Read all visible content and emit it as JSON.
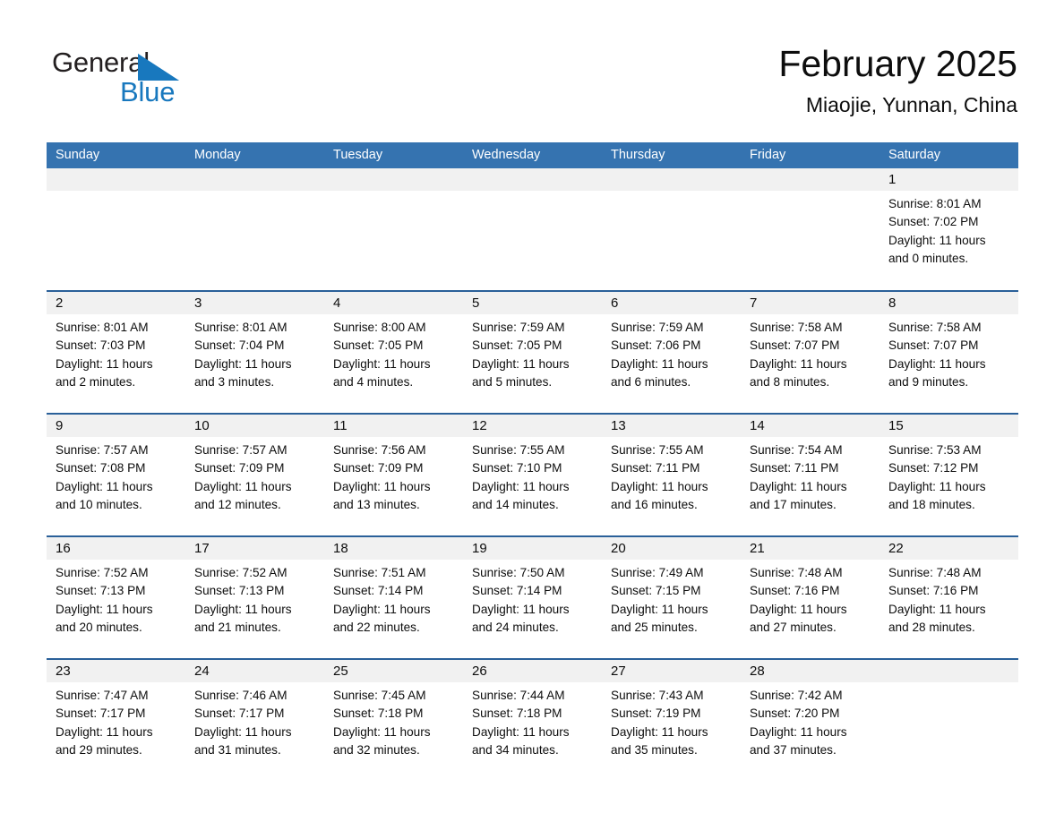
{
  "brand": {
    "name_part1": "General",
    "name_part2": "Blue",
    "triangle_color": "#1878be",
    "text_color": "#231f20"
  },
  "header": {
    "month_title": "February 2025",
    "location": "Miaojie, Yunnan, China"
  },
  "theme": {
    "header_blue": "#3573b0",
    "row_divider_blue": "#2a6099",
    "daynum_band": "#f1f1f1",
    "text": "#0d0d0d",
    "page_background": "#ffffff"
  },
  "weekdays": [
    "Sunday",
    "Monday",
    "Tuesday",
    "Wednesday",
    "Thursday",
    "Friday",
    "Saturday"
  ],
  "weeks": [
    [
      {
        "day": "",
        "lines": []
      },
      {
        "day": "",
        "lines": []
      },
      {
        "day": "",
        "lines": []
      },
      {
        "day": "",
        "lines": []
      },
      {
        "day": "",
        "lines": []
      },
      {
        "day": "",
        "lines": []
      },
      {
        "day": "1",
        "lines": [
          "Sunrise: 8:01 AM",
          "Sunset: 7:02 PM",
          "Daylight: 11 hours",
          "and 0 minutes."
        ]
      }
    ],
    [
      {
        "day": "2",
        "lines": [
          "Sunrise: 8:01 AM",
          "Sunset: 7:03 PM",
          "Daylight: 11 hours",
          "and 2 minutes."
        ]
      },
      {
        "day": "3",
        "lines": [
          "Sunrise: 8:01 AM",
          "Sunset: 7:04 PM",
          "Daylight: 11 hours",
          "and 3 minutes."
        ]
      },
      {
        "day": "4",
        "lines": [
          "Sunrise: 8:00 AM",
          "Sunset: 7:05 PM",
          "Daylight: 11 hours",
          "and 4 minutes."
        ]
      },
      {
        "day": "5",
        "lines": [
          "Sunrise: 7:59 AM",
          "Sunset: 7:05 PM",
          "Daylight: 11 hours",
          "and 5 minutes."
        ]
      },
      {
        "day": "6",
        "lines": [
          "Sunrise: 7:59 AM",
          "Sunset: 7:06 PM",
          "Daylight: 11 hours",
          "and 6 minutes."
        ]
      },
      {
        "day": "7",
        "lines": [
          "Sunrise: 7:58 AM",
          "Sunset: 7:07 PM",
          "Daylight: 11 hours",
          "and 8 minutes."
        ]
      },
      {
        "day": "8",
        "lines": [
          "Sunrise: 7:58 AM",
          "Sunset: 7:07 PM",
          "Daylight: 11 hours",
          "and 9 minutes."
        ]
      }
    ],
    [
      {
        "day": "9",
        "lines": [
          "Sunrise: 7:57 AM",
          "Sunset: 7:08 PM",
          "Daylight: 11 hours",
          "and 10 minutes."
        ]
      },
      {
        "day": "10",
        "lines": [
          "Sunrise: 7:57 AM",
          "Sunset: 7:09 PM",
          "Daylight: 11 hours",
          "and 12 minutes."
        ]
      },
      {
        "day": "11",
        "lines": [
          "Sunrise: 7:56 AM",
          "Sunset: 7:09 PM",
          "Daylight: 11 hours",
          "and 13 minutes."
        ]
      },
      {
        "day": "12",
        "lines": [
          "Sunrise: 7:55 AM",
          "Sunset: 7:10 PM",
          "Daylight: 11 hours",
          "and 14 minutes."
        ]
      },
      {
        "day": "13",
        "lines": [
          "Sunrise: 7:55 AM",
          "Sunset: 7:11 PM",
          "Daylight: 11 hours",
          "and 16 minutes."
        ]
      },
      {
        "day": "14",
        "lines": [
          "Sunrise: 7:54 AM",
          "Sunset: 7:11 PM",
          "Daylight: 11 hours",
          "and 17 minutes."
        ]
      },
      {
        "day": "15",
        "lines": [
          "Sunrise: 7:53 AM",
          "Sunset: 7:12 PM",
          "Daylight: 11 hours",
          "and 18 minutes."
        ]
      }
    ],
    [
      {
        "day": "16",
        "lines": [
          "Sunrise: 7:52 AM",
          "Sunset: 7:13 PM",
          "Daylight: 11 hours",
          "and 20 minutes."
        ]
      },
      {
        "day": "17",
        "lines": [
          "Sunrise: 7:52 AM",
          "Sunset: 7:13 PM",
          "Daylight: 11 hours",
          "and 21 minutes."
        ]
      },
      {
        "day": "18",
        "lines": [
          "Sunrise: 7:51 AM",
          "Sunset: 7:14 PM",
          "Daylight: 11 hours",
          "and 22 minutes."
        ]
      },
      {
        "day": "19",
        "lines": [
          "Sunrise: 7:50 AM",
          "Sunset: 7:14 PM",
          "Daylight: 11 hours",
          "and 24 minutes."
        ]
      },
      {
        "day": "20",
        "lines": [
          "Sunrise: 7:49 AM",
          "Sunset: 7:15 PM",
          "Daylight: 11 hours",
          "and 25 minutes."
        ]
      },
      {
        "day": "21",
        "lines": [
          "Sunrise: 7:48 AM",
          "Sunset: 7:16 PM",
          "Daylight: 11 hours",
          "and 27 minutes."
        ]
      },
      {
        "day": "22",
        "lines": [
          "Sunrise: 7:48 AM",
          "Sunset: 7:16 PM",
          "Daylight: 11 hours",
          "and 28 minutes."
        ]
      }
    ],
    [
      {
        "day": "23",
        "lines": [
          "Sunrise: 7:47 AM",
          "Sunset: 7:17 PM",
          "Daylight: 11 hours",
          "and 29 minutes."
        ]
      },
      {
        "day": "24",
        "lines": [
          "Sunrise: 7:46 AM",
          "Sunset: 7:17 PM",
          "Daylight: 11 hours",
          "and 31 minutes."
        ]
      },
      {
        "day": "25",
        "lines": [
          "Sunrise: 7:45 AM",
          "Sunset: 7:18 PM",
          "Daylight: 11 hours",
          "and 32 minutes."
        ]
      },
      {
        "day": "26",
        "lines": [
          "Sunrise: 7:44 AM",
          "Sunset: 7:18 PM",
          "Daylight: 11 hours",
          "and 34 minutes."
        ]
      },
      {
        "day": "27",
        "lines": [
          "Sunrise: 7:43 AM",
          "Sunset: 7:19 PM",
          "Daylight: 11 hours",
          "and 35 minutes."
        ]
      },
      {
        "day": "28",
        "lines": [
          "Sunrise: 7:42 AM",
          "Sunset: 7:20 PM",
          "Daylight: 11 hours",
          "and 37 minutes."
        ]
      },
      {
        "day": "",
        "lines": []
      }
    ]
  ]
}
